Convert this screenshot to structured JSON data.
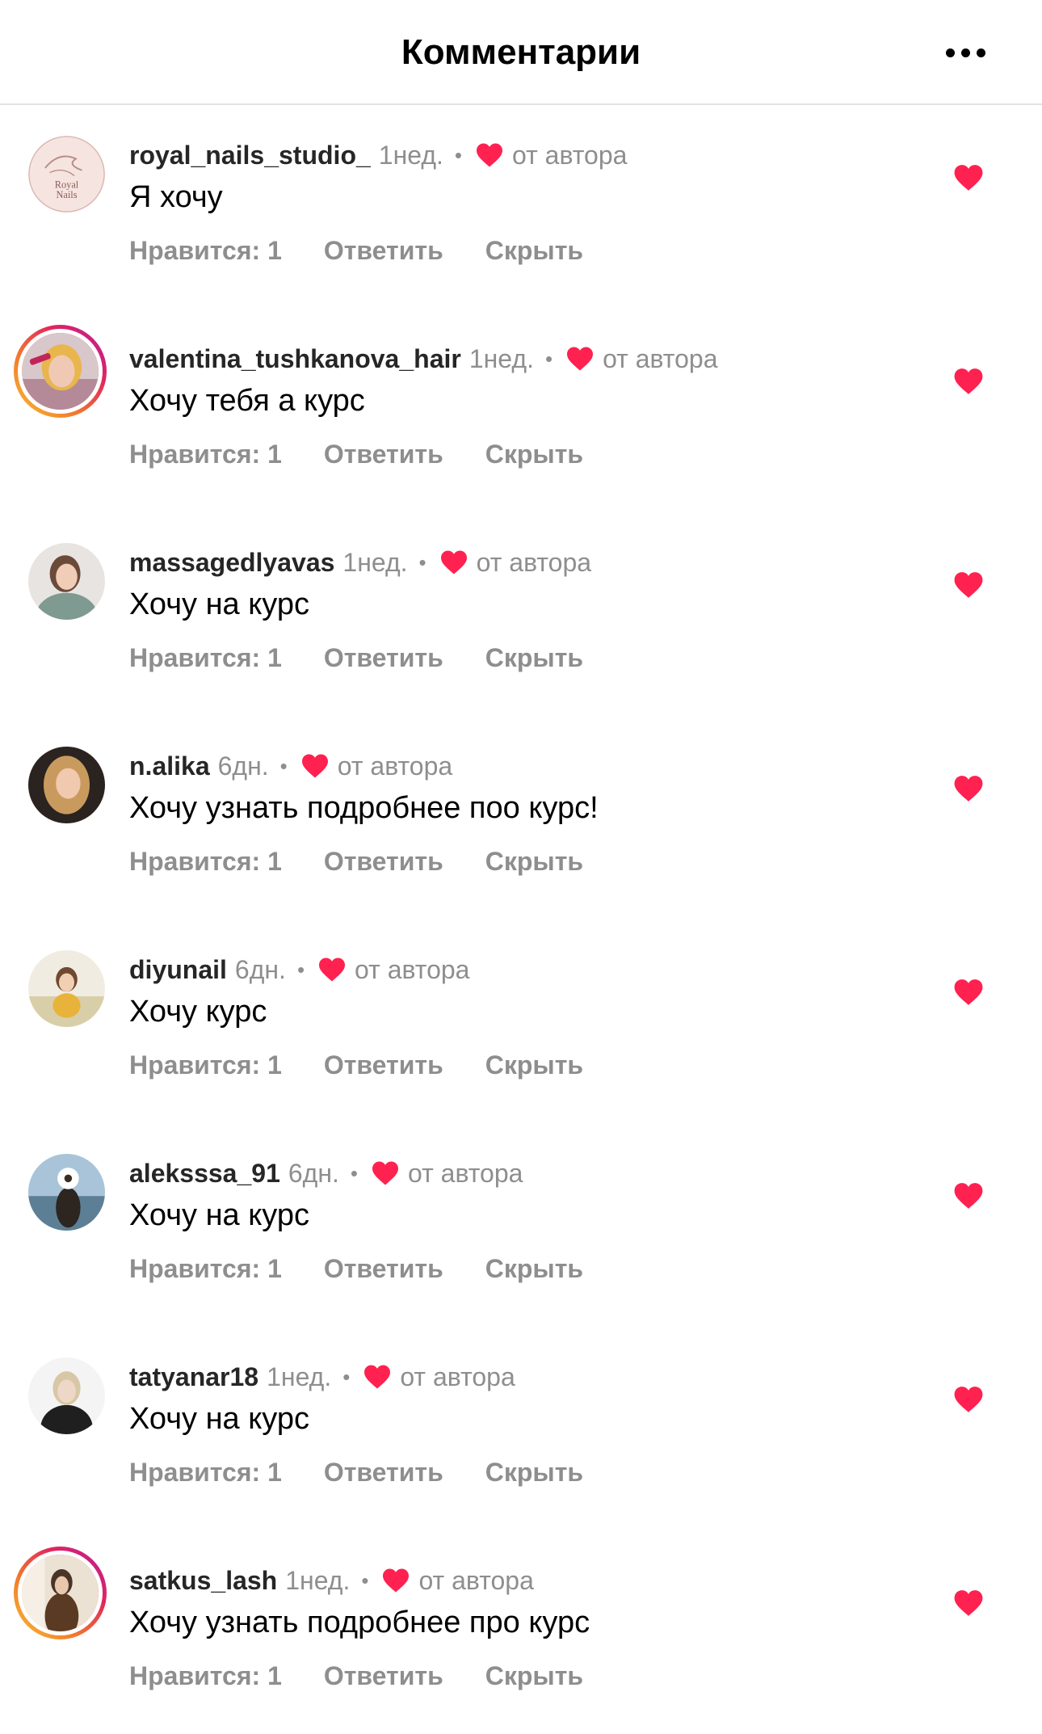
{
  "header": {
    "title": "Комментарии",
    "more_icon": "more-horizontal-icon"
  },
  "colors": {
    "heart": "#ff2150",
    "secondary_text": "#8e8e8e",
    "divider": "#e3e3e3",
    "story_ring": [
      "#f9c232",
      "#e0245e",
      "#b21fa6"
    ]
  },
  "comments": [
    {
      "username": "royal_nails_studio_",
      "time": "1нед.",
      "bullet": "•",
      "author_label": "от автора",
      "text": "Я хочу",
      "likes": "Нравится: 1",
      "reply": "Ответить",
      "hide": "Скрыть",
      "avatar_text": "Royal Nails",
      "story_ring": false,
      "liked": true
    },
    {
      "username": "valentina_tushkanova_hair",
      "time": "1нед.",
      "bullet": "•",
      "author_label": "от автора",
      "text": "Хочу тебя а курс",
      "likes": "Нравится: 1",
      "reply": "Ответить",
      "hide": "Скрыть",
      "story_ring": true,
      "liked": true
    },
    {
      "username": "massagedlyavas",
      "time": "1нед.",
      "bullet": "•",
      "author_label": "от автора",
      "text": "Хочу на курс",
      "likes": "Нравится: 1",
      "reply": "Ответить",
      "hide": "Скрыть",
      "story_ring": false,
      "liked": true
    },
    {
      "username": "n.alika",
      "time": "6дн.",
      "bullet": "•",
      "author_label": "от автора",
      "text": "Хочу узнать подробнее поо курс!",
      "likes": "Нравится: 1",
      "reply": "Ответить",
      "hide": "Скрыть",
      "story_ring": false,
      "liked": true
    },
    {
      "username": "diyunail",
      "time": "6дн.",
      "bullet": "•",
      "author_label": "от автора",
      "text": "Хочу курс",
      "likes": "Нравится: 1",
      "reply": "Ответить",
      "hide": "Скрыть",
      "story_ring": false,
      "liked": true
    },
    {
      "username": "aleksssa_91",
      "time": "6дн.",
      "bullet": "•",
      "author_label": "от автора",
      "text": "Хочу на курс",
      "likes": "Нравится: 1",
      "reply": "Ответить",
      "hide": "Скрыть",
      "story_ring": false,
      "liked": true
    },
    {
      "username": "tatyanar18",
      "time": "1нед.",
      "bullet": "•",
      "author_label": "от автора",
      "text": "Хочу на курс",
      "likes": "Нравится: 1",
      "reply": "Ответить",
      "hide": "Скрыть",
      "story_ring": false,
      "liked": true
    },
    {
      "username": "satkus_lash",
      "time": "1нед.",
      "bullet": "•",
      "author_label": "от автора",
      "text": "Хочу узнать подробнее про курс",
      "likes": "Нравится: 1",
      "reply": "Ответить",
      "hide": "Скрыть",
      "story_ring": true,
      "liked": true
    }
  ]
}
